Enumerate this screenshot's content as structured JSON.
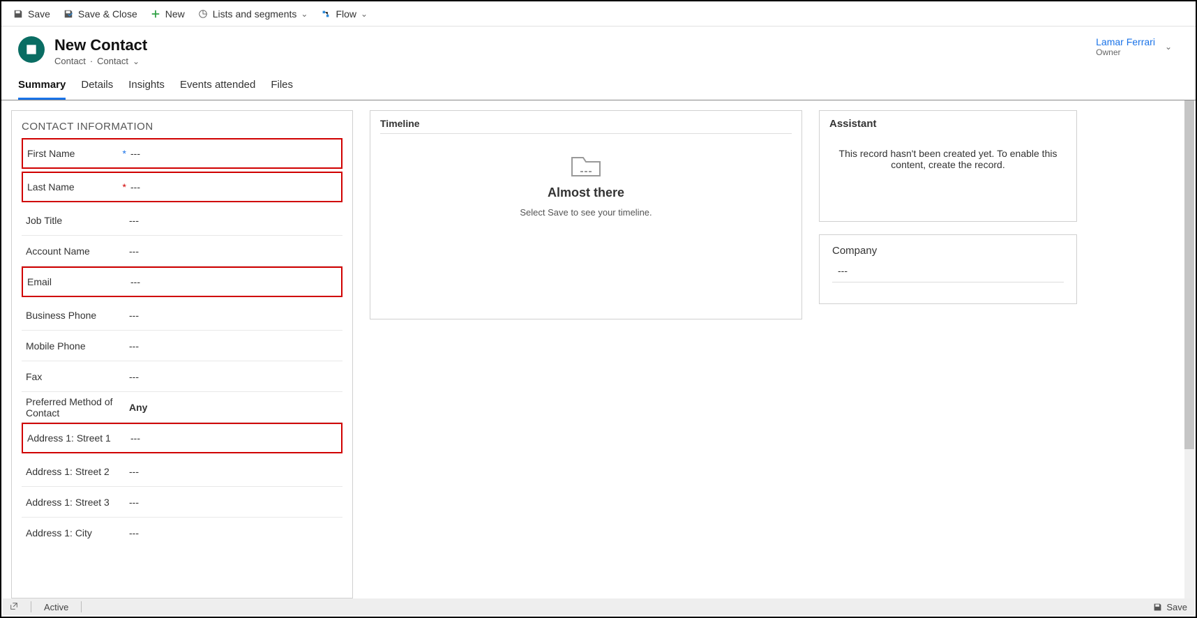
{
  "toolbar": {
    "save": "Save",
    "save_close": "Save & Close",
    "new": "New",
    "lists": "Lists and segments",
    "flow": "Flow"
  },
  "header": {
    "title": "New Contact",
    "subtype1": "Contact",
    "subtype2": "Contact",
    "owner_name": "Lamar Ferrari",
    "owner_label": "Owner"
  },
  "tabs": {
    "summary": "Summary",
    "details": "Details",
    "insights": "Insights",
    "events": "Events attended",
    "files": "Files"
  },
  "contact_section": {
    "title": "CONTACT INFORMATION",
    "fields": {
      "first_name": {
        "label": "First Name",
        "value": "---"
      },
      "last_name": {
        "label": "Last Name",
        "value": "---"
      },
      "job_title": {
        "label": "Job Title",
        "value": "---"
      },
      "account_name": {
        "label": "Account Name",
        "value": "---"
      },
      "email": {
        "label": "Email",
        "value": "---"
      },
      "business_phone": {
        "label": "Business Phone",
        "value": "---"
      },
      "mobile_phone": {
        "label": "Mobile Phone",
        "value": "---"
      },
      "fax": {
        "label": "Fax",
        "value": "---"
      },
      "pref_method": {
        "label": "Preferred Method of Contact",
        "value": "Any"
      },
      "addr1_s1": {
        "label": "Address 1: Street 1",
        "value": "---"
      },
      "addr1_s2": {
        "label": "Address 1: Street 2",
        "value": "---"
      },
      "addr1_s3": {
        "label": "Address 1: Street 3",
        "value": "---"
      },
      "addr1_city": {
        "label": "Address 1: City",
        "value": "---"
      }
    }
  },
  "timeline": {
    "title": "Timeline",
    "heading": "Almost there",
    "sub": "Select Save to see your timeline."
  },
  "assistant": {
    "title": "Assistant",
    "message": "This record hasn't been created yet. To enable this content, create the record."
  },
  "company": {
    "label": "Company",
    "value": "---"
  },
  "statusbar": {
    "status": "Active",
    "save": "Save"
  }
}
